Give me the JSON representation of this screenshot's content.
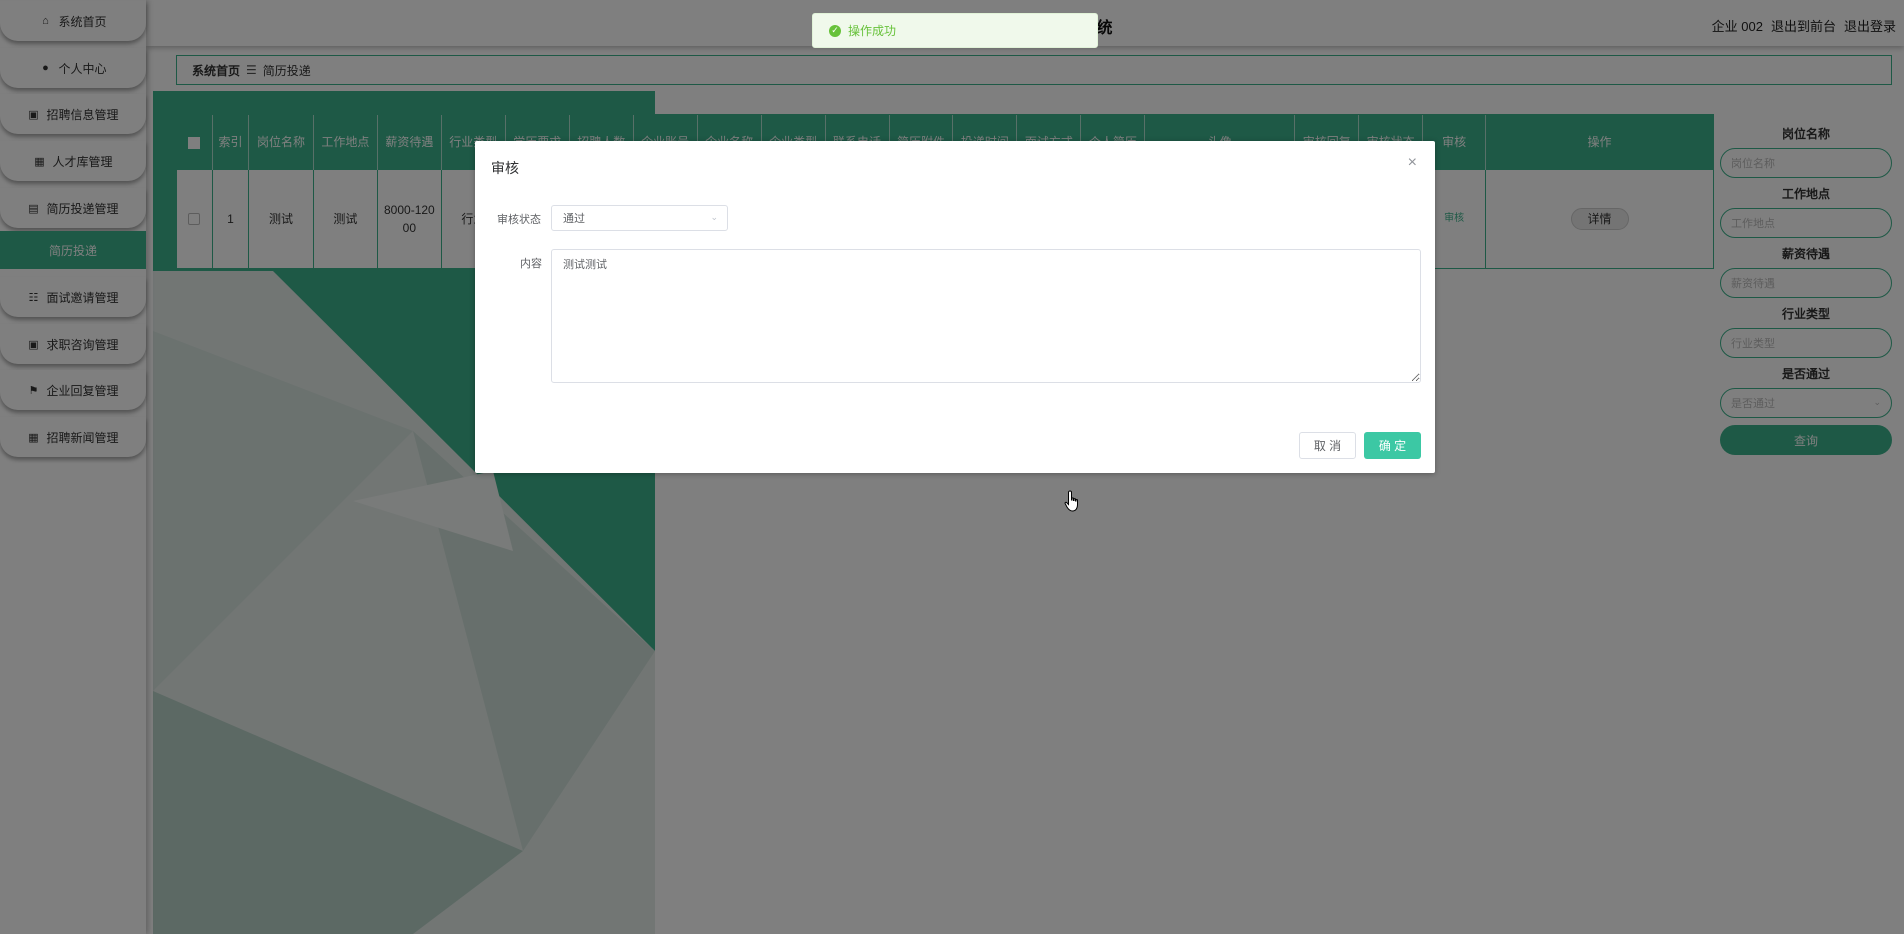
{
  "colors": {
    "accent": "#3cb38c",
    "confirm": "#3cc8a4",
    "toast_success": "#67c23a"
  },
  "header": {
    "title": "基于web的招聘管理系统",
    "user_label": "企业 002",
    "front_link": "退出到前台",
    "logout_link": "退出登录"
  },
  "sidebar": {
    "items": [
      {
        "label": "系统首页",
        "icon": "home-icon"
      },
      {
        "label": "个人中心",
        "icon": "person-icon"
      },
      {
        "label": "招聘信息管理",
        "icon": "briefcase-icon"
      },
      {
        "label": "人才库管理",
        "icon": "grid-icon"
      },
      {
        "label": "简历投递管理",
        "icon": "document-icon"
      },
      {
        "label": "面试邀请管理",
        "icon": "list-icon"
      },
      {
        "label": "求职咨询管理",
        "icon": "badge-icon"
      },
      {
        "label": "企业回复管理",
        "icon": "flag-icon"
      },
      {
        "label": "招聘新闻管理",
        "icon": "grid-icon"
      }
    ],
    "sub_item": "简历投递"
  },
  "breadcrumb": {
    "home": "系统首页",
    "separator": "☰",
    "current": "简历投递"
  },
  "table": {
    "headers": [
      "索引",
      "岗位名称",
      "工作地点",
      "薪资待遇",
      "行业类型",
      "学历要求",
      "招聘人数",
      "企业账号",
      "企业名称",
      "企业类型",
      "联系电话",
      "简历附件",
      "投递时间",
      "面试方式",
      "个人简历",
      "头像",
      "审核回复",
      "审核状态",
      "审核",
      "操作"
    ],
    "rows": [
      {
        "index": "1",
        "job": "测试",
        "location": "测试",
        "salary": "8000-12000",
        "industry": "行业",
        "audit": "审核",
        "detail": "详情"
      }
    ]
  },
  "search": {
    "fields": [
      {
        "label": "岗位名称",
        "placeholder": "岗位名称"
      },
      {
        "label": "工作地点",
        "placeholder": "工作地点"
      },
      {
        "label": "薪资待遇",
        "placeholder": "薪资待遇"
      },
      {
        "label": "行业类型",
        "placeholder": "行业类型"
      },
      {
        "label": "是否通过",
        "placeholder": "是否通过"
      }
    ],
    "button": "查询"
  },
  "toast": {
    "message": "操作成功"
  },
  "dialog": {
    "title": "审核",
    "status_label": "审核状态",
    "status_value": "通过",
    "content_label": "内容",
    "content_value": "测试测试",
    "cancel": "取 消",
    "confirm": "确 定"
  }
}
